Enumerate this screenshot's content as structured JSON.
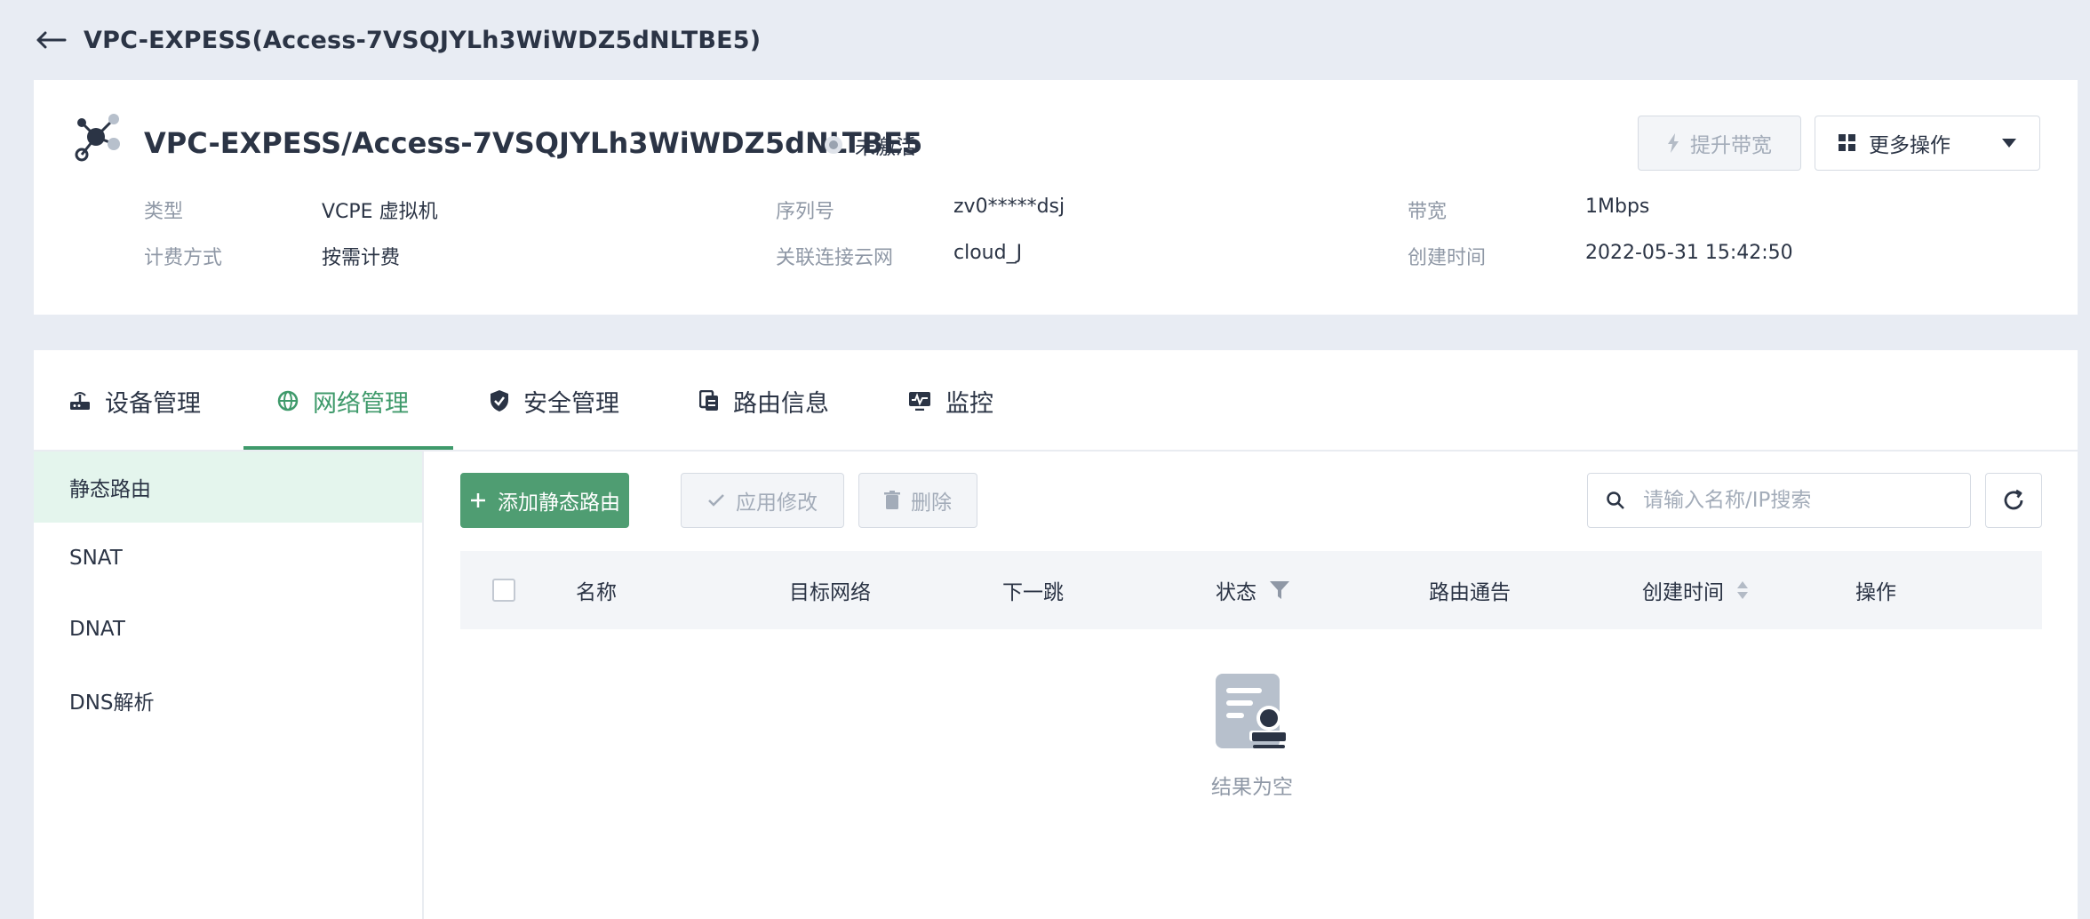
{
  "page": {
    "title": "VPC-EXPESS(Access-7VSQJYLh3WiWDZ5dNLTBE5)"
  },
  "device": {
    "name": "VPC-EXPESS/Access-7VSQJYLh3WiWDZ5dNLTBE5",
    "status": "未激活",
    "actions": {
      "upgrade": "提升带宽",
      "more": "更多操作"
    },
    "meta": [
      {
        "label": "类型",
        "value": "VCPE 虚拟机"
      },
      {
        "label": "序列号",
        "value": "zv0*****dsj"
      },
      {
        "label": "带宽",
        "value": "1Mbps"
      },
      {
        "label": "计费方式",
        "value": "按需计费"
      },
      {
        "label": "关联连接云网",
        "value": "cloud_J"
      },
      {
        "label": "创建时间",
        "value": "2022-05-31 15:42:50"
      }
    ]
  },
  "tabs": [
    {
      "label": "设备管理",
      "icon": "router-icon"
    },
    {
      "label": "网络管理",
      "icon": "globe-icon"
    },
    {
      "label": "安全管理",
      "icon": "shield-icon"
    },
    {
      "label": "路由信息",
      "icon": "route-info-icon"
    },
    {
      "label": "监控",
      "icon": "monitor-icon"
    }
  ],
  "active_tab": "网络管理",
  "sidenav": [
    {
      "label": "静态路由"
    },
    {
      "label": "SNAT"
    },
    {
      "label": "DNAT"
    },
    {
      "label": "DNS解析"
    }
  ],
  "toolbar": {
    "add_label": "添加静态路由",
    "apply_label": "应用修改",
    "delete_label": "删除",
    "search_placeholder": "请输入名称/IP搜索",
    "search_value": ""
  },
  "table": {
    "columns": [
      "名称",
      "目标网络",
      "下一跳",
      "状态",
      "路由通告",
      "创建时间",
      "操作"
    ],
    "rows": []
  },
  "empty_text": "结果为空",
  "colors": {
    "accent": "#4f9d72",
    "background": "#e8ecf3",
    "text": "#2b3445",
    "muted": "#8f98a6"
  }
}
